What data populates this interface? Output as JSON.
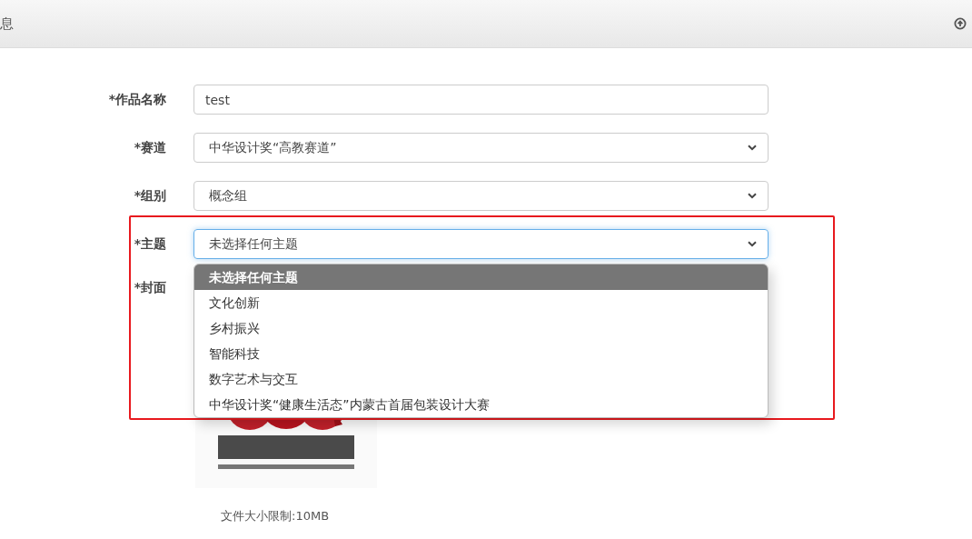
{
  "header": {
    "title": "息"
  },
  "fields": [
    {
      "label": "*作品名称",
      "kind": "input",
      "value": "test",
      "focused": false
    },
    {
      "label": "*赛道",
      "kind": "select",
      "value": "中华设计奖“高教赛道”",
      "focused": false
    },
    {
      "label": "*组别",
      "kind": "select",
      "value": "概念组",
      "focused": false
    },
    {
      "label": "*主题",
      "kind": "select",
      "value": "未选择任何主题",
      "focused": true,
      "options": [
        {
          "label": "未选择任何主题",
          "selected": true
        },
        {
          "label": "文化创新",
          "selected": false
        },
        {
          "label": "乡村振兴",
          "selected": false
        },
        {
          "label": "智能科技",
          "selected": false
        },
        {
          "label": "数字艺术与交互",
          "selected": false
        },
        {
          "label": "中华设计奖“健康生活态”内蒙古首届包装设计大赛",
          "selected": false
        }
      ]
    },
    {
      "label": "*封面"
    }
  ],
  "note": "文件大小限制:10MB"
}
